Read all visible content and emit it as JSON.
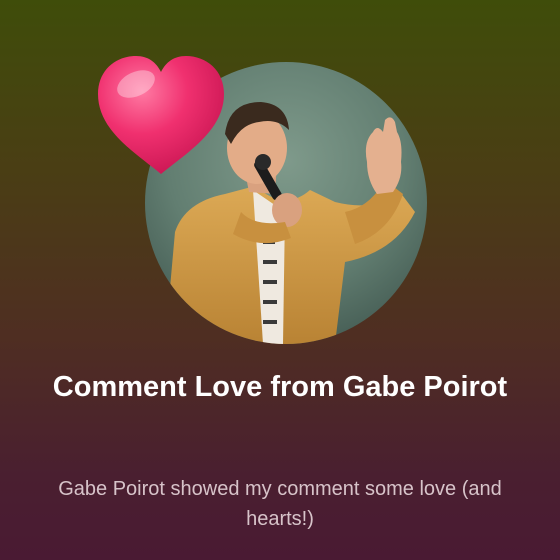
{
  "card": {
    "title": "Comment Love from Gabe Poirot",
    "description": "Gabe Poirot showed my comment some love (and hearts!)"
  },
  "icons": {
    "badge": "heart-icon"
  },
  "colors": {
    "gradient_top": "#3f4d0a",
    "gradient_bottom": "#4a1a33",
    "heart": "#f0306f",
    "jacket": "#d19b45",
    "photo_backdrop": "#6e8a7c"
  }
}
